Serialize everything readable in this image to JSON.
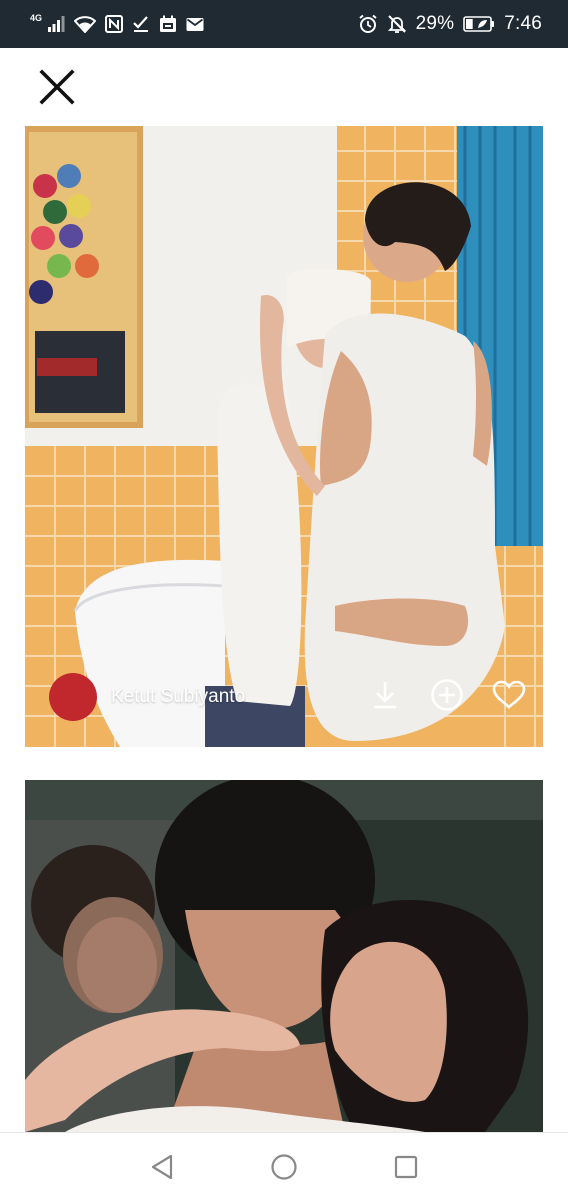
{
  "status_bar": {
    "network_type": "4G",
    "battery_percent": "29%",
    "time": "7:46",
    "left_icons": [
      "signal-icon",
      "wifi-icon",
      "nfc-icon",
      "check-icon",
      "calendar-icon",
      "mail-icon"
    ],
    "right_icons": [
      "alarm-icon",
      "mute-icon",
      "battery-icon"
    ],
    "battery_level": 0.29
  },
  "top_bar": {
    "close_icon": "close-icon"
  },
  "feed": {
    "photos": [
      {
        "author": "Ketut Subiyanto",
        "avatar_color": "#c0282d",
        "actions": [
          "download-icon",
          "add-circle-icon",
          "heart-icon"
        ]
      },
      {}
    ]
  },
  "nav_bar": {
    "buttons": [
      "back-icon",
      "home-icon",
      "recents-icon"
    ]
  },
  "colors": {
    "status_bar_bg": "#1f2a33",
    "avatar": "#c0282d"
  }
}
